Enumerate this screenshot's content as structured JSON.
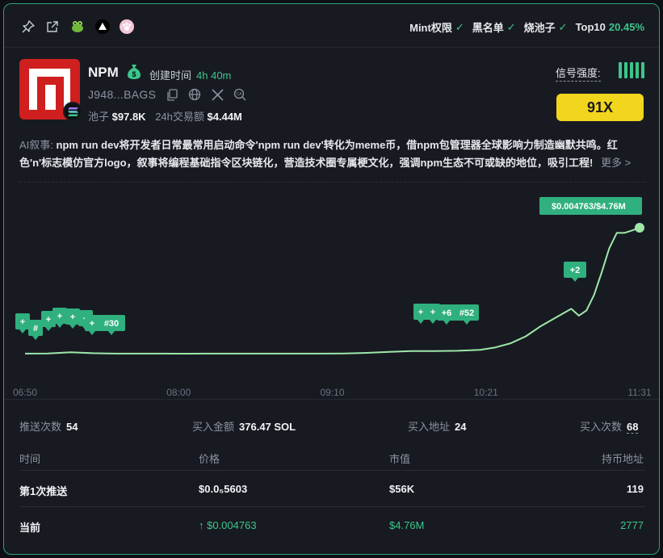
{
  "topbar": {
    "icons": [
      "pin-icon",
      "external-link-icon",
      "frog-icon",
      "triangle-icon",
      "paw-icon"
    ],
    "checks": [
      {
        "label": "Mint权限"
      },
      {
        "label": "黑名单"
      },
      {
        "label": "烧池子"
      }
    ],
    "top10": {
      "label": "Top10",
      "value": "20.45%"
    }
  },
  "token": {
    "name": "NPM",
    "created_label": "创建时间",
    "created_value": "4h 40m",
    "address": "J948...BAGS",
    "pool_label": "池子",
    "pool_value": "$97.8K",
    "vol_label": "24h交易额",
    "vol_value": "$4.44M"
  },
  "signal": {
    "label": "信号强度:",
    "bars": 5,
    "multiplier": "91X"
  },
  "narrative": {
    "label": "AI叙事:",
    "text": "npm run dev将开发者日常最常用启动命令'npm run dev'转化为meme币，借npm包管理器全球影响力制造幽默共鸣。红色'n'标志模仿官方logo，叙事将编程基础指令区块链化，营造技术圈专属梗文化，强调npm生态不可或缺的地位，吸引工程!",
    "more": "更多 >"
  },
  "chart_data": {
    "type": "line",
    "x_ticks": [
      "06:50",
      "08:00",
      "09:10",
      "10:21",
      "11:31"
    ],
    "x": [
      0,
      3,
      6,
      9,
      12,
      15,
      18,
      21,
      24,
      27,
      30,
      33,
      36,
      39,
      42,
      45,
      48,
      51,
      54,
      57,
      60,
      62,
      64,
      66,
      68,
      70,
      72,
      73,
      74,
      75,
      76,
      77,
      78,
      79,
      80,
      81
    ],
    "y": [
      0.05,
      0.055,
      0.09,
      0.06,
      0.05,
      0.05,
      0.05,
      0.048,
      0.05,
      0.05,
      0.05,
      0.05,
      0.05,
      0.05,
      0.055,
      0.07,
      0.1,
      0.125,
      0.125,
      0.13,
      0.16,
      0.23,
      0.35,
      0.55,
      0.85,
      1.1,
      1.35,
      1.15,
      1.3,
      1.75,
      2.4,
      3.1,
      3.55,
      3.55,
      3.62,
      3.7
    ],
    "y_unit": "relative",
    "end_label": "$0.004763/$4.76M",
    "tags": [
      {
        "label": "+"
      },
      {
        "label": "#"
      },
      {
        "label": "+"
      },
      {
        "label": "+"
      },
      {
        "label": "+"
      },
      {
        "label": "+"
      },
      {
        "label": "+"
      },
      {
        "label": "#30"
      },
      {
        "label": "+"
      },
      {
        "label": "+"
      },
      {
        "label": "+6"
      },
      {
        "label": "#52"
      },
      {
        "label": "+2"
      }
    ]
  },
  "summary": {
    "push_label": "推送次数",
    "push_value": "54",
    "buy_amt_label": "买入金额",
    "buy_amt_value": "376.47 SOL",
    "buy_addr_label": "买入地址",
    "buy_addr_value": "24",
    "buy_cnt_label": "买入次数",
    "buy_cnt_value": "68"
  },
  "table": {
    "headers": [
      "时间",
      "价格",
      "市值",
      "持币地址"
    ],
    "rows": [
      {
        "time": "第1次推送",
        "price": "$0.0₅5603",
        "mcap": "$56K",
        "holders": "119"
      },
      {
        "time": "当前",
        "price": "↑ $0.004763",
        "mcap": "$4.76M",
        "holders": "2777"
      }
    ]
  }
}
